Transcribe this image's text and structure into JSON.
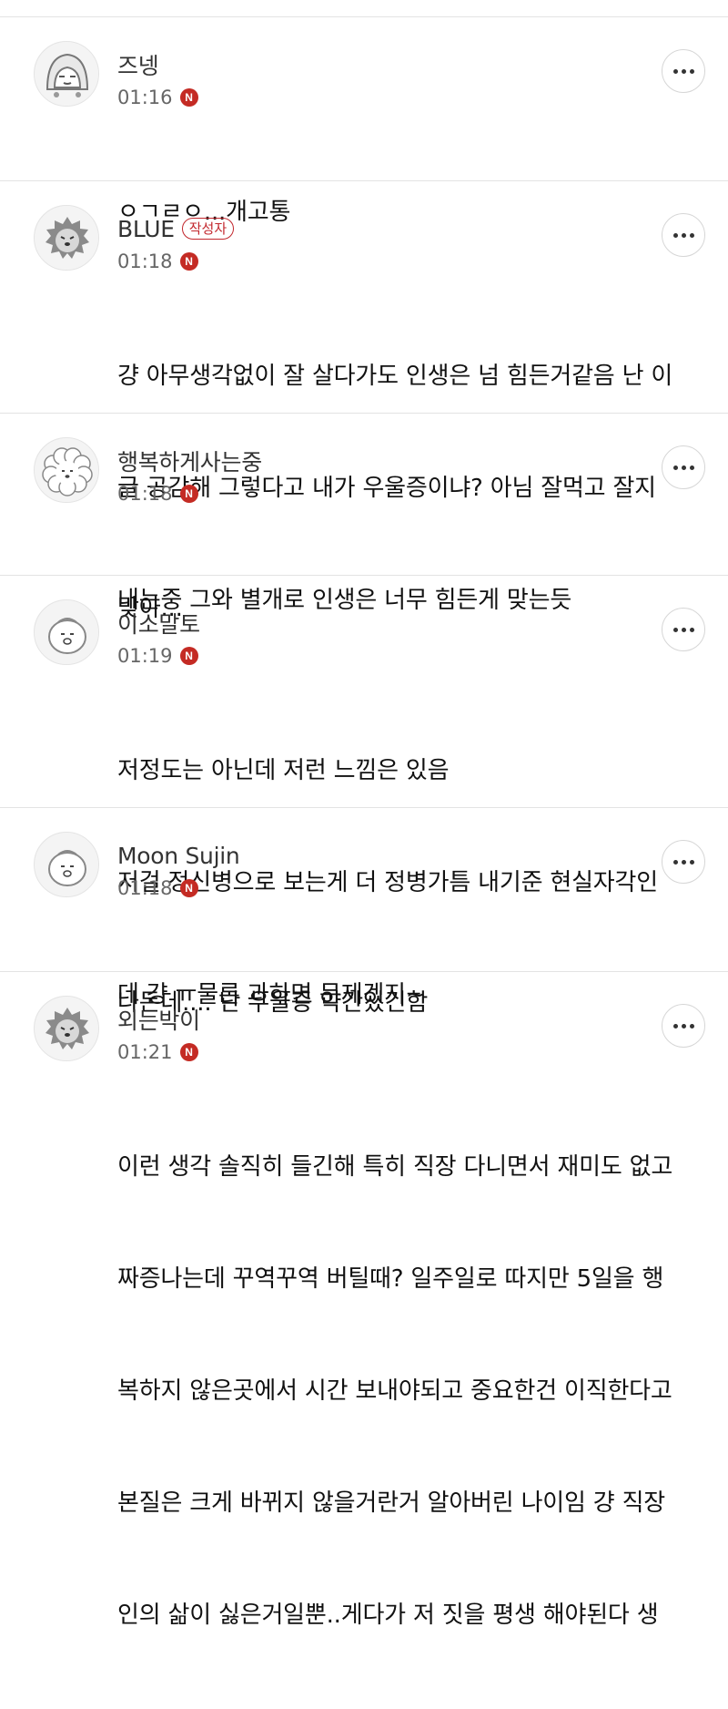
{
  "comments": [
    {
      "author": "즈넹",
      "is_writer": false,
      "time": "01:16",
      "new_badge": "N",
      "avatar_icon": "hooded-character-avatar-icon",
      "lines": [
        "ㅇㄱㄹㅇ...개고통"
      ]
    },
    {
      "author": "BLUE",
      "is_writer": true,
      "writer_badge": "작성자",
      "time": "01:18",
      "new_badge": "N",
      "avatar_icon": "hedgehog-character-avatar-icon",
      "lines": [
        "걍 아무생각없이 잘 살다가도 인생은 넘 힘든거같음 난 이",
        "글 공감해 그렇다고 내가 우울증이냐? 아님 잘먹고 잘지",
        "내는중 그와 별개로 인생은 너무 힘든게 맞는듯"
      ]
    },
    {
      "author": "행복하게사는중",
      "is_writer": false,
      "time": "01:18",
      "new_badge": "N",
      "avatar_icon": "sheep-character-avatar-icon",
      "lines": [
        "맞아..."
      ]
    },
    {
      "author": "이소말토",
      "is_writer": false,
      "time": "01:19",
      "new_badge": "N",
      "avatar_icon": "round-character-avatar-icon",
      "lines": [
        "저정도는 아닌데 저런 느낌은 있음",
        "저걸 정신병으로 보는게 더 정병가틈 내기준 현실자각인",
        "데 걍 ㅠ물론 과하면 문제겠지~"
      ]
    },
    {
      "author": "Moon Sujin",
      "is_writer": false,
      "time": "01:18",
      "new_badge": "N",
      "avatar_icon": "round-character-avatar-icon",
      "lines": [
        "나돈데.... 난 우울증 약간있긴함"
      ]
    },
    {
      "author": "외는박이",
      "is_writer": false,
      "time": "01:21",
      "new_badge": "N",
      "avatar_icon": "hedgehog-character-avatar-icon",
      "lines": [
        "이런 생각 솔직히 들긴해 특히 직장 다니면서 재미도 없고",
        "짜증나는데 꾸역꾸역 버틸때? 일주일로 따지만 5일을 행",
        "복하지 않은곳에서 시간 보내야되고 중요한건 이직한다고",
        "본질은 크게 바뀌지 않을거란거 알아버린 나이임 걍 직장",
        "인의 삶이 싫은거일뿐..게다가 저 짓을 평생 해야된다 생"
      ]
    }
  ]
}
